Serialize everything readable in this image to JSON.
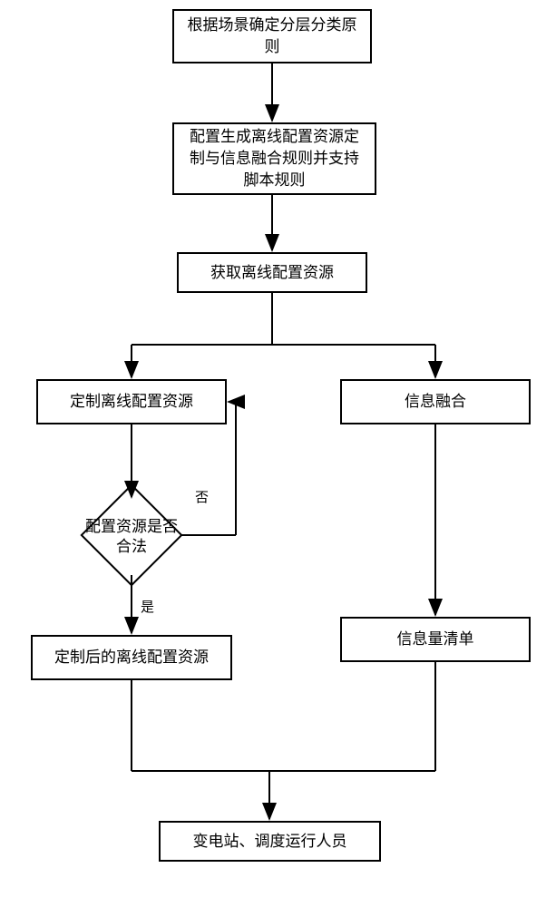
{
  "nodes": {
    "n1": "根据场景确定分层分类原\n则",
    "n2": "配置生成离线配置资源定\n制与信息融合规则并支持\n脚本规则",
    "n3": "获取离线配置资源",
    "n4": "定制离线配置资源",
    "n5": "信息融合",
    "n6": "配置资源是否\n合法",
    "n7": "定制后的离线配置资源",
    "n8": "信息量清单",
    "n9": "变电站、调度运行人员"
  },
  "labels": {
    "no": "否",
    "yes": "是"
  }
}
